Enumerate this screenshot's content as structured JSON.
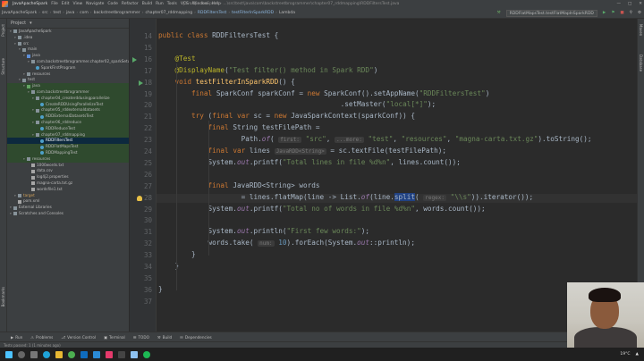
{
  "menubar": {
    "project": "JavaApacheSpark",
    "items": [
      "File",
      "Edit",
      "View",
      "Navigate",
      "Code",
      "Refactor",
      "Build",
      "Run",
      "Tools",
      "VCS",
      "Window",
      "Help"
    ],
    "title": "JavaApacheSpark – ...\\src\\test\\java\\com\\backstreetbrogrammer\\chapter07_rddmapping\\RDDFiltersTest.java"
  },
  "navbar": {
    "crumbs": [
      "JavaApacheSpark",
      "src",
      "test",
      "java",
      "com",
      "backstreetbrogrammer",
      "chapter07_rddmapping"
    ],
    "file_a": "RDDFiltersTest",
    "file_b": "testFilterInSparkRDD",
    "extra": "Lambda",
    "run_config": "RDDFlatMapsTest.testFlatMapInSparkRDD"
  },
  "left_strip": {
    "project": "Project",
    "structure": "Structure",
    "bookmarks": "Bookmarks"
  },
  "right_strip": {
    "maven": "Maven",
    "database": "Database"
  },
  "project_panel": {
    "title": "Project",
    "tree": [
      {
        "label": "JavaApacheSpark",
        "indent": 0,
        "icon": "f",
        "cls": ""
      },
      {
        "label": ".idea",
        "indent": 1,
        "icon": "f",
        "cls": ""
      },
      {
        "label": "src",
        "indent": 1,
        "icon": "f",
        "cls": ""
      },
      {
        "label": "main",
        "indent": 2,
        "icon": "f",
        "cls": ""
      },
      {
        "label": "java",
        "indent": 3,
        "icon": "s",
        "cls": ""
      },
      {
        "label": "com.backstreetbrogrammer.chapter02_sparkSetup",
        "indent": 4,
        "icon": "f",
        "cls": ""
      },
      {
        "label": "SparkFirstProgram",
        "indent": 5,
        "icon": "j",
        "cls": ""
      },
      {
        "label": "resources",
        "indent": 3,
        "icon": "f",
        "cls": ""
      },
      {
        "label": "test",
        "indent": 2,
        "icon": "f",
        "cls": ""
      },
      {
        "label": "java",
        "indent": 3,
        "icon": "t",
        "cls": "tsrc"
      },
      {
        "label": "com.backstreetbrogrammer",
        "indent": 4,
        "icon": "f",
        "cls": "tsrc"
      },
      {
        "label": "chapter04_createrddusingparallelize",
        "indent": 5,
        "icon": "f",
        "cls": "tsrc"
      },
      {
        "label": "CreateRDDUsingParallelizeTest",
        "indent": 6,
        "icon": "j",
        "cls": "tsrc"
      },
      {
        "label": "chapter05_rddexternaldatasets",
        "indent": 5,
        "icon": "f",
        "cls": "tsrc"
      },
      {
        "label": "RDDExternalDatasetsTest",
        "indent": 6,
        "icon": "j",
        "cls": "tsrc"
      },
      {
        "label": "chapter06_rddreduce",
        "indent": 5,
        "icon": "f",
        "cls": "tsrc"
      },
      {
        "label": "RDDReduceTest",
        "indent": 6,
        "icon": "j",
        "cls": "tsrc"
      },
      {
        "label": "chapter07_rddmapping",
        "indent": 5,
        "icon": "f",
        "cls": "tsrc"
      },
      {
        "label": "RDDFiltersTest",
        "indent": 6,
        "icon": "j",
        "cls": "sel"
      },
      {
        "label": "RDDFlatMapsTest",
        "indent": 6,
        "icon": "j",
        "cls": "tsrc"
      },
      {
        "label": "RDDMappingTest",
        "indent": 6,
        "icon": "j",
        "cls": "tsrc"
      },
      {
        "label": "resources",
        "indent": 3,
        "icon": "f",
        "cls": "tsrc"
      },
      {
        "label": "1000words.txt",
        "indent": 4,
        "icon": "x",
        "cls": ""
      },
      {
        "label": "data.csv",
        "indent": 4,
        "icon": "x",
        "cls": ""
      },
      {
        "label": "log4j2.properties",
        "indent": 4,
        "icon": "x",
        "cls": ""
      },
      {
        "label": "magna-carta.txt.gz",
        "indent": 4,
        "icon": "x",
        "cls": ""
      },
      {
        "label": "wordsfile1.txt",
        "indent": 4,
        "icon": "x",
        "cls": ""
      },
      {
        "label": "target",
        "indent": 1,
        "icon": "f",
        "cls": "tgt"
      },
      {
        "label": "pom.xml",
        "indent": 1,
        "icon": "x",
        "cls": ""
      },
      {
        "label": "External Libraries",
        "indent": 0,
        "icon": "f",
        "cls": ""
      },
      {
        "label": "Scratches and Consoles",
        "indent": 0,
        "icon": "f",
        "cls": ""
      }
    ]
  },
  "editor": {
    "current_line": 28,
    "lines": [
      {
        "no": 14,
        "html": "<span class=\"kw\">public class</span> RDDFiltersTest {"
      },
      {
        "no": 15,
        "html": ""
      },
      {
        "no": 16,
        "html": "    <span class=\"an\">@Test</span>"
      },
      {
        "no": 17,
        "html": "    <span class=\"an\">@DisplayName</span>(<span class=\"str\">\"Test filter() method in Spark RDD\"</span>)"
      },
      {
        "no": 18,
        "html": "    <span class=\"kw\">void</span> <span class=\"fn\">testFilterInSparkRDD</span>() {"
      },
      {
        "no": 19,
        "html": "        <span class=\"kw\">final</span> SparkConf sparkConf = <span class=\"kw\">new</span> SparkConf().setAppName(<span class=\"str\">\"RDDFiltersTest\"</span>)"
      },
      {
        "no": 20,
        "html": "                                            .setMaster(<span class=\"str\">\"local[*]\"</span>);"
      },
      {
        "no": 21,
        "html": "        <span class=\"kw\">try</span> (<span class=\"kw\">final var</span> sc = <span class=\"kw\">new</span> JavaSparkContext(sparkConf)) {"
      },
      {
        "no": 22,
        "html": "            <span class=\"kw\">final</span> String testFilePath ="
      },
      {
        "no": 23,
        "html": "                    Path.<span class=\"st\">of</span>( <span class=\"hint\">first:</span> <span class=\"str\">\"src\"</span>, <span class=\"hint\">...more:</span> <span class=\"str\">\"test\"</span>, <span class=\"str\">\"resources\"</span>, <span class=\"str\">\"magna-carta.txt.gz\"</span>).toString();"
      },
      {
        "no": 24,
        "html": "            <span class=\"kw\">final var</span> lines <span class=\"hint\">JavaRDD&lt;String&gt;</span> = sc.textFile(testFilePath);"
      },
      {
        "no": 25,
        "html": "            System.<span class=\"st\">out</span>.printf(<span class=\"str\">\"Total lines in file %d%n\"</span>, lines.count());"
      },
      {
        "no": 26,
        "html": ""
      },
      {
        "no": 27,
        "html": "            <span class=\"kw\">final</span> JavaRDD&lt;String&gt; words"
      },
      {
        "no": 28,
        "html": "                    = lines.flatMap(line -&gt; List.<span class=\"st\">of</span>(line.<span class=\"selw\">split</span>( <span class=\"hint\">regex:</span> <span class=\"str\">\"\\\\s\"</span>)).iterator());"
      },
      {
        "no": 29,
        "html": "            System.<span class=\"st\">out</span>.printf(<span class=\"str\">\"Total no of words in file %d%n\"</span>, words.count());"
      },
      {
        "no": 30,
        "html": ""
      },
      {
        "no": 31,
        "html": "            System.<span class=\"st\">out</span>.println(<span class=\"str\">\"First few words:\"</span>);"
      },
      {
        "no": 32,
        "html": "            words.take( <span class=\"hint\">num:</span> <span class=\"num\">10</span>).forEach(System.<span class=\"st\">out</span>::println);"
      },
      {
        "no": 33,
        "html": "        }"
      },
      {
        "no": 34,
        "html": "    }"
      },
      {
        "no": 35,
        "html": ""
      },
      {
        "no": 36,
        "html": "}"
      },
      {
        "no": 37,
        "html": ""
      }
    ]
  },
  "bottom_tools": [
    "Run",
    "Problems",
    "Version Control",
    "Terminal",
    "TODO",
    "Build",
    "Dependencies"
  ],
  "status": {
    "text": "Tests passed: 1 (1 minutes ago)"
  },
  "taskbar": {
    "weather": "19°C",
    "clock": "..."
  },
  "colors": {
    "keyword": "#cc7832",
    "string": "#6a8759",
    "annotation": "#bbb529",
    "method": "#ffc66d",
    "selection": "#214283"
  }
}
